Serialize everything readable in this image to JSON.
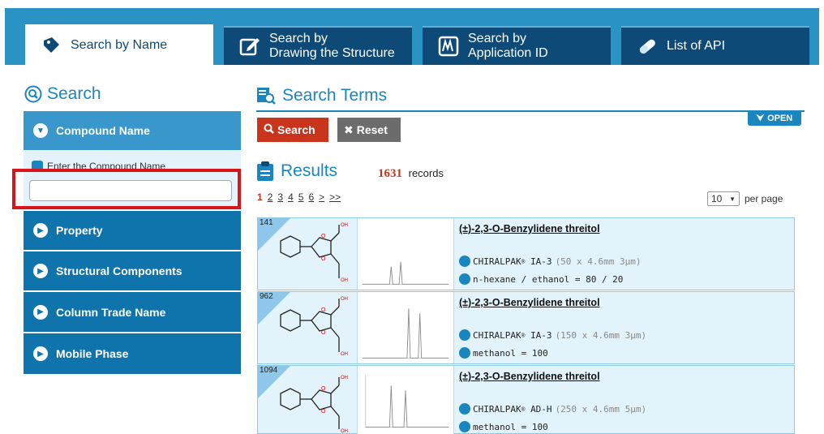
{
  "tabs": [
    {
      "label": "Search by Name",
      "icon": "tag-icon"
    },
    {
      "label": "Search by\nDrawing the Structure",
      "icon": "pencil-square-icon"
    },
    {
      "label": "Search by\nApplication ID",
      "icon": "chart-box-icon"
    },
    {
      "label": "List of API",
      "icon": "capsule-icon"
    }
  ],
  "sidebar": {
    "title": "Search",
    "sections": [
      {
        "label": "Compound Name",
        "open": true
      },
      {
        "label": "Property"
      },
      {
        "label": "Structural Components"
      },
      {
        "label": "Column Trade Name"
      },
      {
        "label": "Mobile Phase"
      }
    ],
    "compound_field_label": "Enter the Compound Name",
    "compound_value": ""
  },
  "main": {
    "search_terms_title": "Search Terms",
    "open_label": "OPEN",
    "search_button": "Search",
    "reset_button": "Reset",
    "results_title": "Results",
    "records_count": "1631",
    "records_label": "records",
    "pages": [
      "1",
      "2",
      "3",
      "4",
      "5",
      "6",
      ">",
      ">>"
    ],
    "current_page": "1",
    "per_page_value": "10",
    "per_page_label": "per page"
  },
  "results": [
    {
      "id": "141",
      "compound": "(±)-2,3-O-Benzylidene threitol",
      "column": "CHIRALPAK",
      "column_model": "IA-3",
      "column_dims": "(50 x 4.6mm 3μm)",
      "mobile_phase": "n-hexane / ethanol = 80 / 20"
    },
    {
      "id": "962",
      "compound": "(±)-2,3-O-Benzylidene threitol",
      "column": "CHIRALPAK",
      "column_model": "IA-3",
      "column_dims": "(150 x 4.6mm 3μm)",
      "mobile_phase": "methanol = 100"
    },
    {
      "id": "1094",
      "compound": "(±)-2,3-O-Benzylidene threitol",
      "column": "CHIRALPAK",
      "column_model": "AD-H",
      "column_dims": "(250 x 4.6mm 5μm)",
      "mobile_phase": "methanol = 100"
    }
  ],
  "colors": {
    "brand_blue": "#1a86bf",
    "dark_navy": "#0d4a77",
    "search_red": "#c9351c",
    "highlight_red": "#d9141b"
  }
}
